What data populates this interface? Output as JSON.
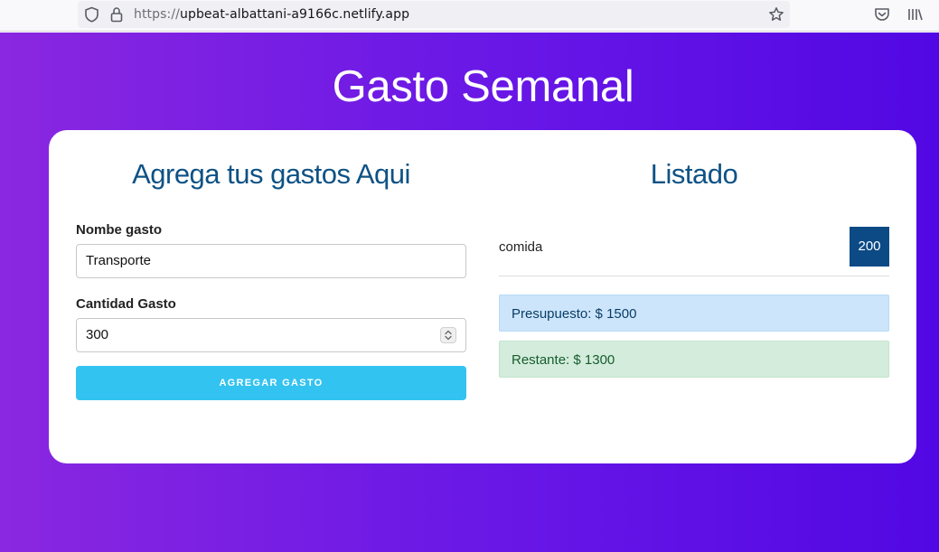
{
  "browser": {
    "url_scheme": "https://",
    "url_host": "upbeat-albattani-a9166c.netlify.app",
    "icons": [
      "shield-icon",
      "lock-icon",
      "bookmark-star-icon",
      "pocket-icon",
      "library-icon"
    ]
  },
  "app": {
    "title": "Gasto Semanal"
  },
  "form": {
    "title": "Agrega tus gastos Aqui",
    "name_label": "Nombe gasto",
    "name_value": "Transporte",
    "amount_label": "Cantidad Gasto",
    "amount_value": "300",
    "submit_label": "Agregar Gasto"
  },
  "list": {
    "title": "Listado",
    "items": [
      {
        "name": "comida",
        "amount": "200"
      }
    ],
    "budget_text": "Presupuesto: $ 1500",
    "remaining_text": "Restante: $ 1300"
  },
  "colors": {
    "gradient_start": "#8a27e0",
    "gradient_end": "#5208e4",
    "heading": "#0e5285",
    "button": "#33c3f0",
    "amount_badge": "#0c4a86",
    "budget_alert": "#cce5fb",
    "remaining_alert": "#d4ecdc"
  }
}
